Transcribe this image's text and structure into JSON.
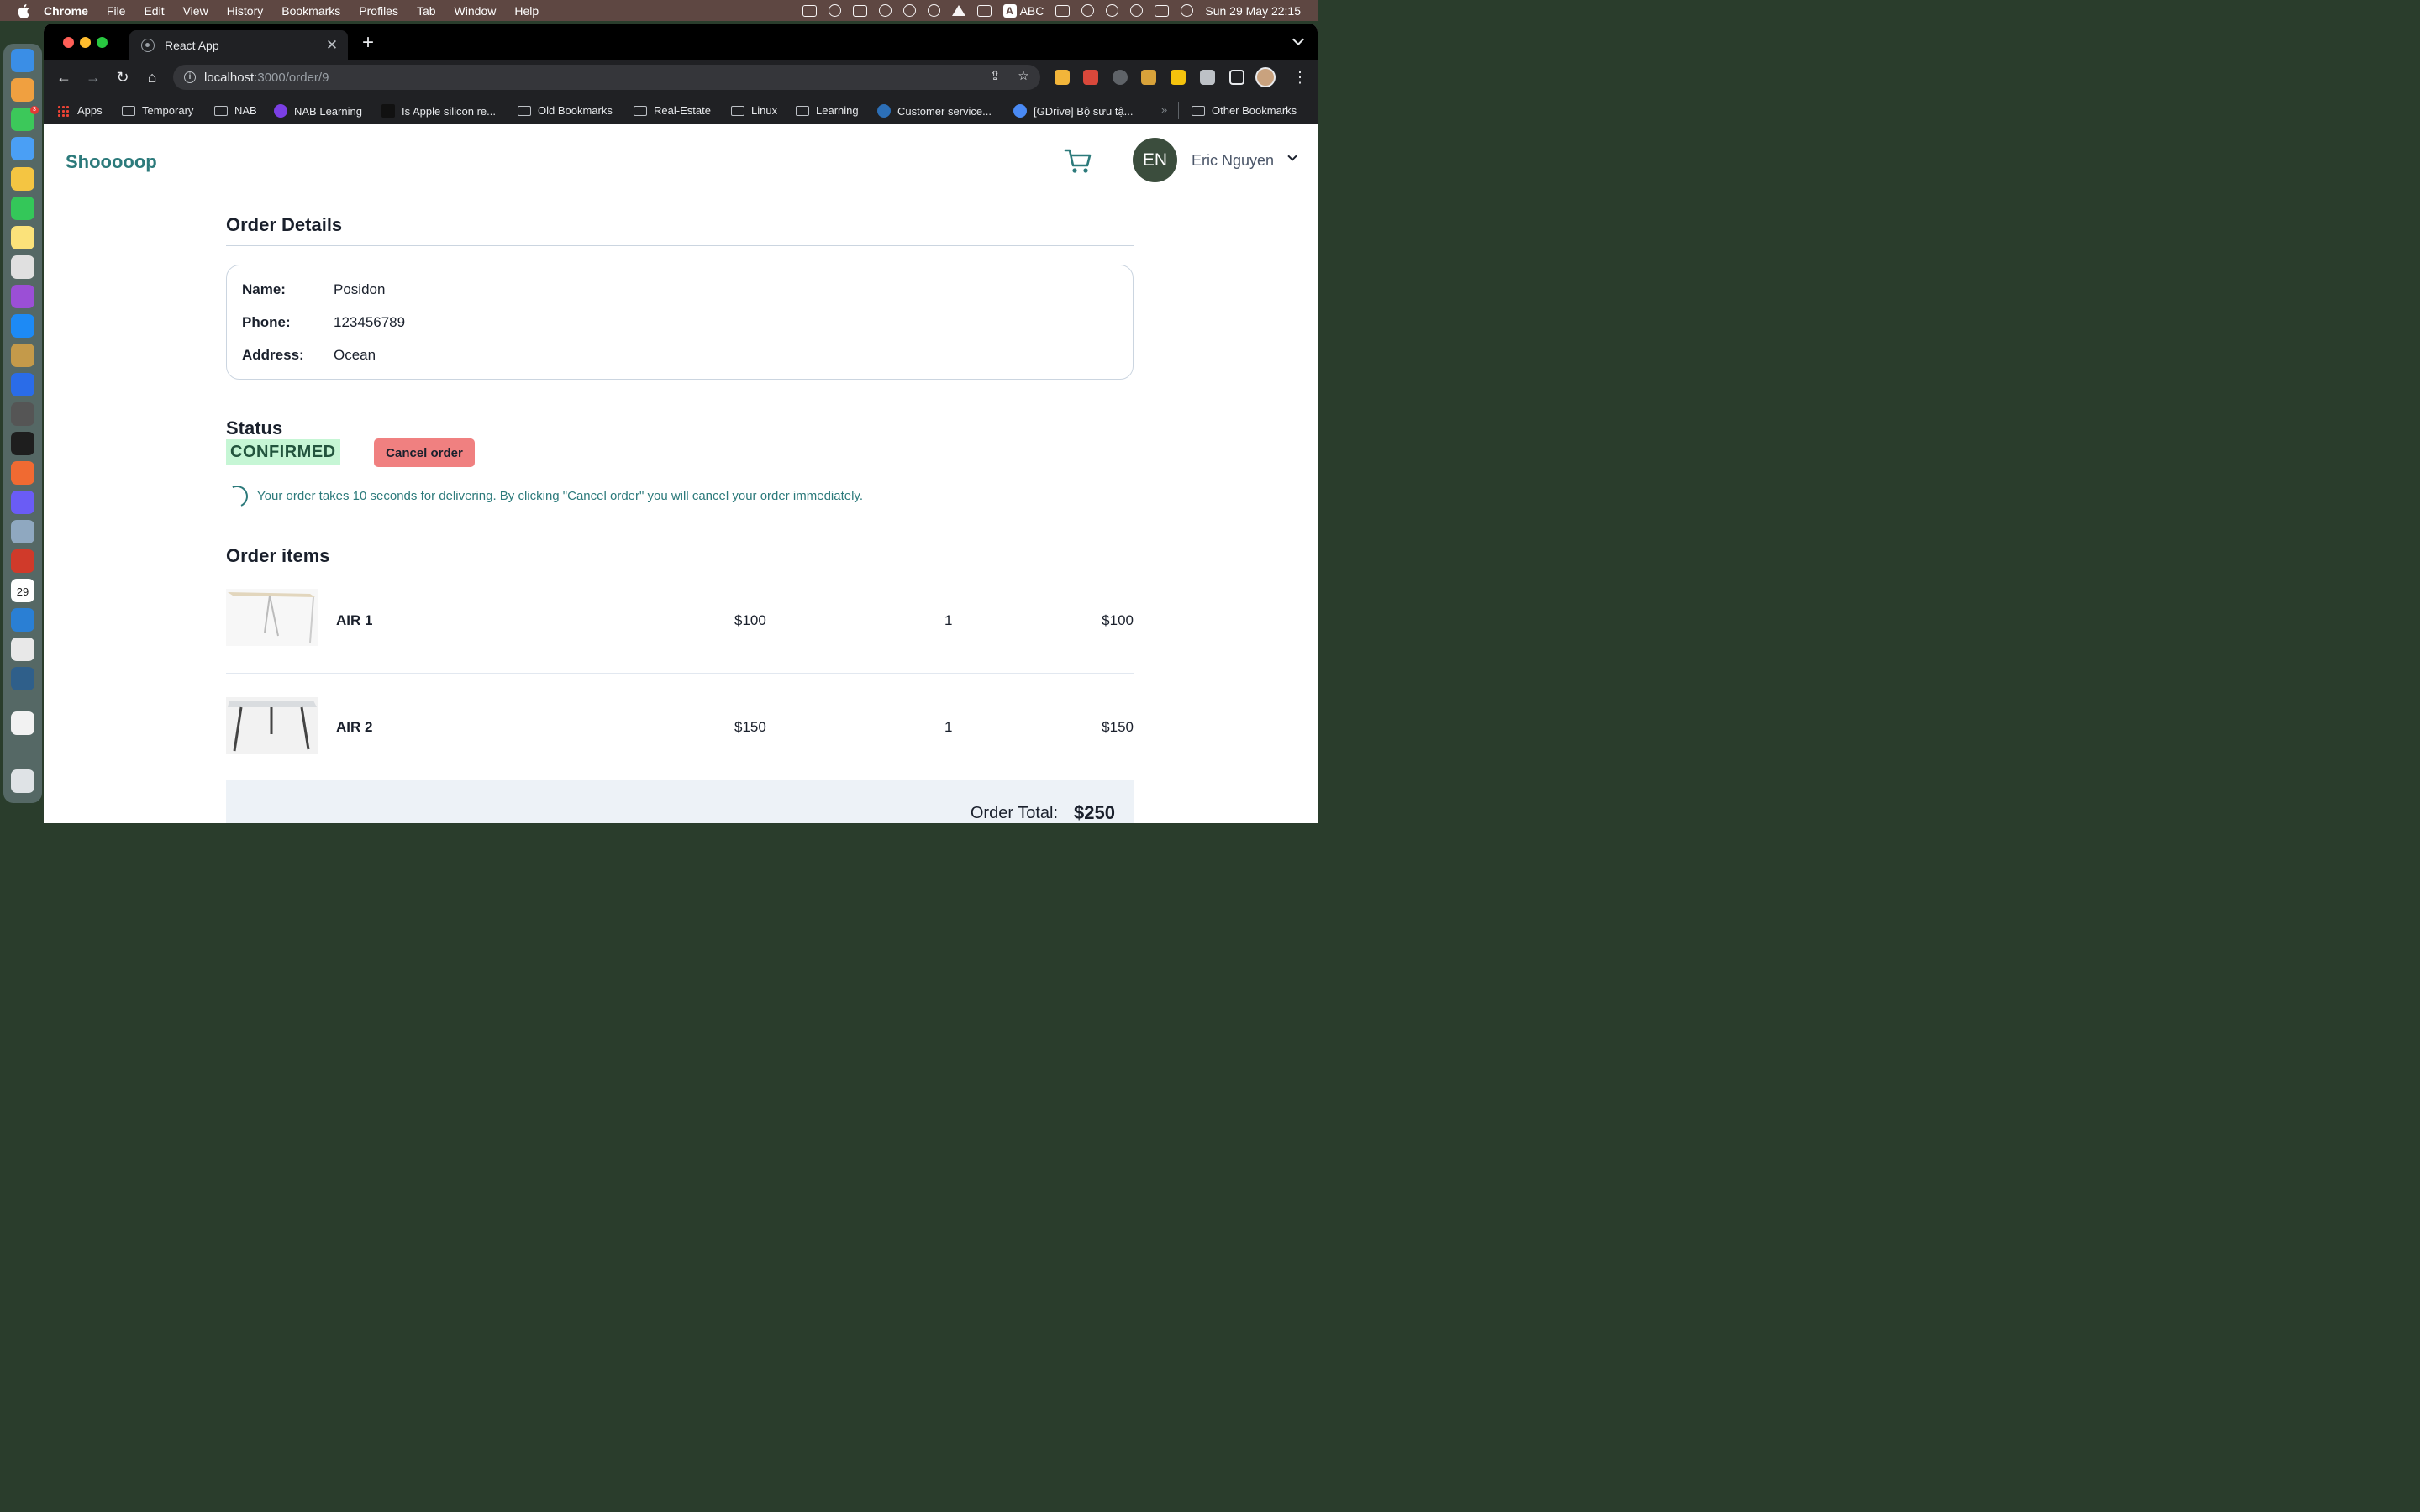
{
  "menubar": {
    "app": "Chrome",
    "items": [
      "File",
      "Edit",
      "View",
      "History",
      "Bookmarks",
      "Profiles",
      "Tab",
      "Window",
      "Help"
    ],
    "input_source": "ABC",
    "datetime": "Sun 29 May  22:15"
  },
  "dock": {
    "calendar_day": "29",
    "calendar_month": "MAY",
    "messages_badge": "3"
  },
  "browser": {
    "tab_title": "React App",
    "url_host": "localhost",
    "url_path": ":3000/order/9",
    "bookmarks": [
      "Apps",
      "Temporary",
      "NAB",
      "NAB Learning",
      "Is Apple silicon re...",
      "Old Bookmarks",
      "Real-Estate",
      "Linux",
      "Learning",
      "Customer service...",
      "[GDrive] Bộ sưu tậ..."
    ],
    "bookmarks_more": "»",
    "other_bookmarks": "Other Bookmarks"
  },
  "header": {
    "brand": "Shooooop",
    "avatar_initials": "EN",
    "user_name": "Eric Nguyen"
  },
  "order": {
    "title": "Order Details",
    "name_label": "Name:",
    "name": "Posidon",
    "phone_label": "Phone:",
    "phone": "123456789",
    "address_label": "Address:",
    "address": "Ocean",
    "status_title": "Status",
    "status": "CONFIRMED",
    "cancel_label": "Cancel order",
    "delivery_message": "Your order takes 10 seconds for delivering. By clicking \"Cancel order\" you will cancel your order immediately.",
    "items_title": "Order items",
    "items": [
      {
        "name": "AIR 1",
        "price": "$100",
        "qty": "1",
        "total": "$100"
      },
      {
        "name": "AIR 2",
        "price": "$150",
        "qty": "1",
        "total": "$150"
      }
    ],
    "total_label": "Order Total:",
    "total_value": "$250"
  },
  "colors": {
    "brand": "#2c7a7b",
    "status_bg": "#c6f6d5",
    "status_text": "#22543d",
    "cancel_bg": "#f08080"
  }
}
